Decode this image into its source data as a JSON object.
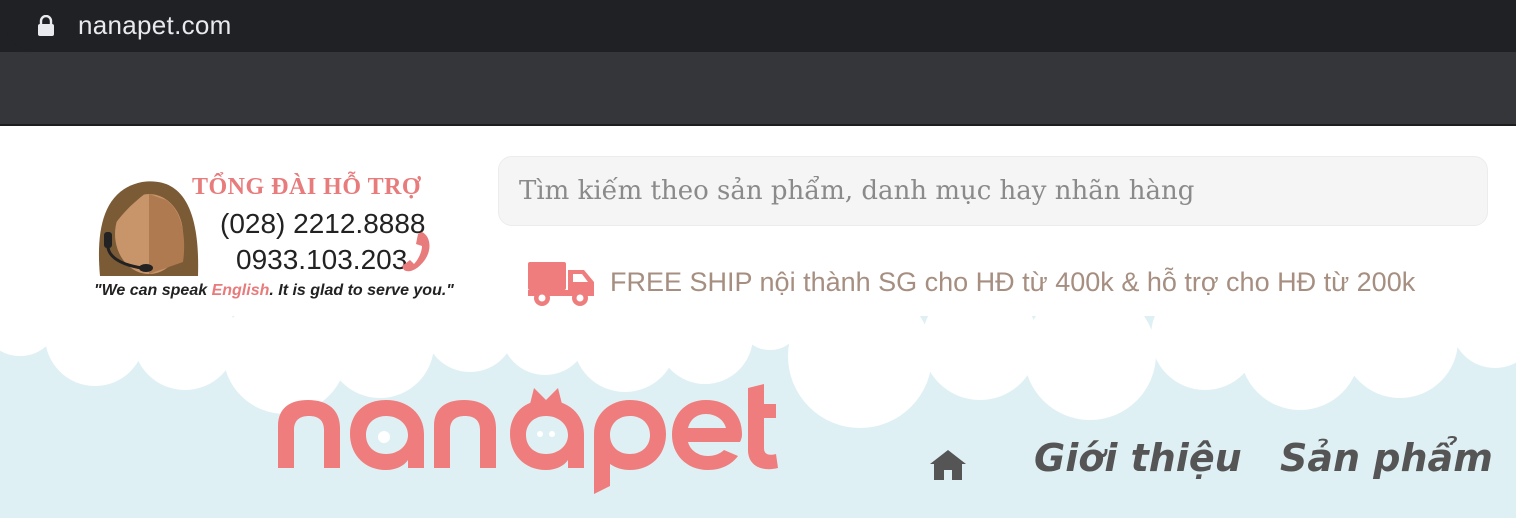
{
  "browser": {
    "url": "nanapet.com"
  },
  "hotline": {
    "title": "TỔNG ĐÀI HỖ TRỢ",
    "phone1": "(028) 2212.8888",
    "phone2": "0933.103.203",
    "slogan_pre": "\"We can speak ",
    "slogan_lang": "English",
    "slogan_post": ". It is glad to serve you.\""
  },
  "search": {
    "placeholder": "Tìm kiếm theo sản phẩm, danh mục hay nhãn hàng",
    "value": ""
  },
  "shipping": {
    "text": "FREE SHIP nội thành SG cho HĐ từ 400k & hỗ trợ cho HĐ từ 200k"
  },
  "brand": {
    "logo_text": "nanapet"
  },
  "nav": {
    "home_icon": "home-icon",
    "items": [
      {
        "label": "Giới thiệu"
      },
      {
        "label": "Sản phẩm"
      }
    ]
  },
  "colors": {
    "brand_pink": "#ef7d7d",
    "sky": "#dff0f4",
    "nav_text": "#555555",
    "ship_text": "#a68e80"
  }
}
